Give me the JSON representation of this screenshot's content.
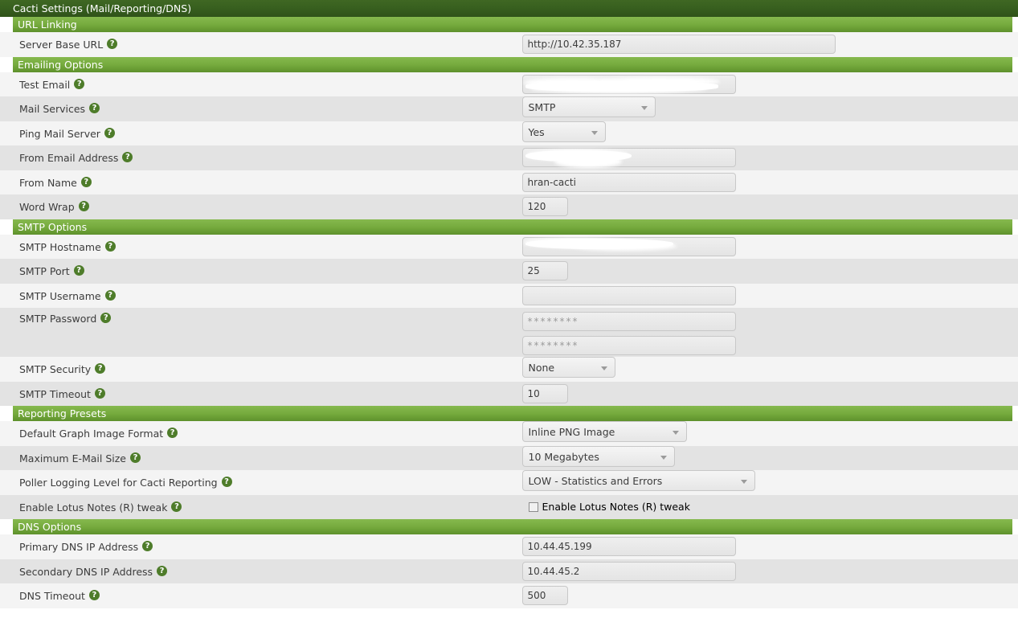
{
  "window": {
    "title": "Cacti Settings (Mail/Reporting/DNS)"
  },
  "icons": {
    "help": "?",
    "help_name": "help-icon",
    "caret": "chevron-down-icon"
  },
  "sections": [
    {
      "id": "url-linking",
      "heading": "URL Linking",
      "rows": [
        {
          "label": "Server Base URL",
          "help": true,
          "control": "text",
          "size": "wide",
          "value": "http://10.42.35.187",
          "name": "server-base-url"
        }
      ]
    },
    {
      "id": "emailing-options",
      "heading": "Emailing Options",
      "rows": [
        {
          "label": "Test Email",
          "help": true,
          "control": "text",
          "size": "medium",
          "value": "",
          "redacted": "blob-wide",
          "name": "test-email"
        },
        {
          "label": "Mail Services",
          "help": true,
          "control": "select",
          "size": "md",
          "value": "SMTP",
          "name": "mail-services"
        },
        {
          "label": "Ping Mail Server",
          "help": true,
          "control": "select",
          "size": "xs",
          "value": "Yes",
          "name": "ping-mail-server"
        },
        {
          "label": "From Email Address",
          "help": true,
          "control": "text",
          "size": "medium",
          "value": "",
          "redacted": "blob-mid",
          "name": "from-email-address"
        },
        {
          "label": "From Name",
          "help": true,
          "control": "text",
          "size": "medium",
          "value": "hran-cacti",
          "name": "from-name"
        },
        {
          "label": "Word Wrap",
          "help": true,
          "control": "text",
          "size": "small",
          "value": "120",
          "name": "word-wrap"
        }
      ]
    },
    {
      "id": "smtp-options",
      "heading": "SMTP Options",
      "rows": [
        {
          "label": "SMTP Hostname",
          "help": true,
          "control": "text",
          "size": "medium",
          "value": "",
          "redacted": "blob-host",
          "name": "smtp-hostname"
        },
        {
          "label": "SMTP Port",
          "help": true,
          "control": "text",
          "size": "small",
          "value": "25",
          "name": "smtp-port"
        },
        {
          "label": "SMTP Username",
          "help": true,
          "control": "text",
          "size": "medium",
          "value": "",
          "name": "smtp-username"
        },
        {
          "label": "SMTP Password",
          "help": true,
          "control": "password-pair",
          "size": "medium",
          "value": "********",
          "value2": "********",
          "name": "smtp-password"
        },
        {
          "label": "SMTP Security",
          "help": true,
          "control": "select",
          "size": "sm",
          "value": "None",
          "name": "smtp-security"
        },
        {
          "label": "SMTP Timeout",
          "help": true,
          "control": "text",
          "size": "small",
          "value": "10",
          "name": "smtp-timeout"
        }
      ]
    },
    {
      "id": "reporting-presets",
      "heading": "Reporting Presets",
      "rows": [
        {
          "label": "Default Graph Image Format",
          "help": true,
          "control": "select",
          "size": "xl",
          "value": "Inline PNG Image",
          "name": "default-graph-image-format"
        },
        {
          "label": "Maximum E-Mail Size",
          "help": true,
          "control": "select",
          "size": "lg",
          "value": "10 Megabytes",
          "name": "maximum-email-size"
        },
        {
          "label": "Poller Logging Level for Cacti Reporting",
          "help": true,
          "control": "select",
          "size": "xxl",
          "value": "LOW - Statistics and Errors",
          "name": "poller-logging-level"
        },
        {
          "label": "Enable Lotus Notes (R) tweak",
          "help": true,
          "control": "checkbox",
          "checked": false,
          "checkbox_label": "Enable Lotus Notes (R) tweak",
          "name": "enable-lotus-notes-tweak"
        }
      ]
    },
    {
      "id": "dns-options",
      "heading": "DNS Options",
      "rows": [
        {
          "label": "Primary DNS IP Address",
          "help": true,
          "control": "text",
          "size": "medium",
          "value": "10.44.45.199",
          "name": "primary-dns-ip-address"
        },
        {
          "label": "Secondary DNS IP Address",
          "help": true,
          "control": "text",
          "size": "medium",
          "value": "10.44.45.2",
          "name": "secondary-dns-ip-address"
        },
        {
          "label": "DNS Timeout",
          "help": true,
          "control": "text",
          "size": "small",
          "value": "500",
          "name": "dns-timeout"
        }
      ]
    }
  ],
  "colors": {
    "title_bar": "#38601f",
    "section_bar": "#76ab3e",
    "row_odd": "#f4f4f4",
    "row_even": "#e3e3e3",
    "label_text": "#3c3c3c",
    "help_icon": "#4e7c2a"
  }
}
